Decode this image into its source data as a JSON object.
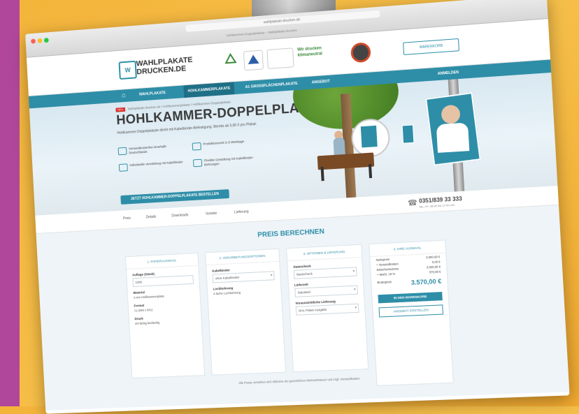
{
  "browser": {
    "address": "wahlplakate-drucken.de",
    "tab_title": "Hohlkammer-Doppelplakate – Wahlplakate drucken"
  },
  "header": {
    "logo_mark": "W",
    "logo_text": "WAHLPLAKATE DRUCKEN.DE",
    "badge_text": "Wir drucken klimaneutral",
    "button": "WARENKORB"
  },
  "nav": {
    "items": [
      "WAHLPLAKATE",
      "HOHLKAMMERPLAKATE",
      "A1 GROSSFLÄCHENPLAKATE",
      "ANGEBOT"
    ],
    "right": "ANMELDEN"
  },
  "hero": {
    "new_tag": "NEU",
    "breadcrumb": "Wahlplakate-drucken.de / Hohlkammerplakate / Hohlkammer-Doppelplakate",
    "title": "HOHLKAMMER-DOPPELPLAKATE",
    "description": "Hohlkammer-Doppelplakate direkt mit Kabelbinder-Befestigung. Bereits ab 5,00 € pro Plakat.",
    "features": [
      "Versandkostenfrei innerhalb Deutschlands",
      "Produktionszeit 3–5 Werktage",
      "Individuelle Veredelung mit Kabelbinder",
      "Flexible Gestaltung mit Kabelbinder-Bohrungen"
    ],
    "cta": "JETZT HOHLKAMMER-DOPPELPLAKATE BESTELLEN"
  },
  "subnav": {
    "items": [
      "Preis",
      "Details",
      "Downloads",
      "Vorteile",
      "Lieferung"
    ],
    "phone": "0351/839 33 333",
    "phone_hours": "Mo.–Fr. 08:00 bis 17:00 Uhr"
  },
  "calculator": {
    "heading": "PREIS BERECHNEN",
    "col1": {
      "title": "1. PAPIERAUSWAHL",
      "label_qty": "Auflage (Stück)",
      "qty": "1000",
      "label_material": "Material",
      "material": "4 mm Hohlkammerplatte",
      "label_format": "Format",
      "format": "A1 (594 x 841)",
      "label_print": "Druck",
      "print": "4/4-farbig beidseitig"
    },
    "col2": {
      "title": "2. VERARBEITUNGSOPTIONEN",
      "label_finish": "Kabelbinder",
      "finish": "ohne Kabelbinder",
      "label_drill": "Lochbohrung",
      "drill": "4-fache Lochbohrung"
    },
    "col3": {
      "title": "3. OPTIONEN & LIEFERUNG",
      "label_proof": "Datencheck",
      "proof": "Basischeck",
      "label_ship": "Lieferzeit",
      "ship": "Standard",
      "label_delivery": "Voraussichtliche Lieferung",
      "delivery": "DHL Paket Ausgabe"
    },
    "col4": {
      "title": "4. IHRE AUSWAHL",
      "rows": [
        {
          "label": "Nettopreis",
          "value": "3.000,00 €"
        },
        {
          "label": "+ Versandkosten",
          "value": "0,00 €"
        },
        {
          "label": "Zwischensumme",
          "value": "3.000,00 €"
        },
        {
          "label": "+ MwSt. 19 %",
          "value": "570,00 €"
        }
      ],
      "total_label": "Bruttopreis",
      "total": "3.570,00 €",
      "order_button": "IN DEN WARENKORB",
      "offer_button": "ANGEBOT ERSTELLEN"
    },
    "footnote": "Alle Preise verstehen sich inklusive der gesetzlichen Mehrwertsteuer und zzgl. Versandkosten."
  }
}
